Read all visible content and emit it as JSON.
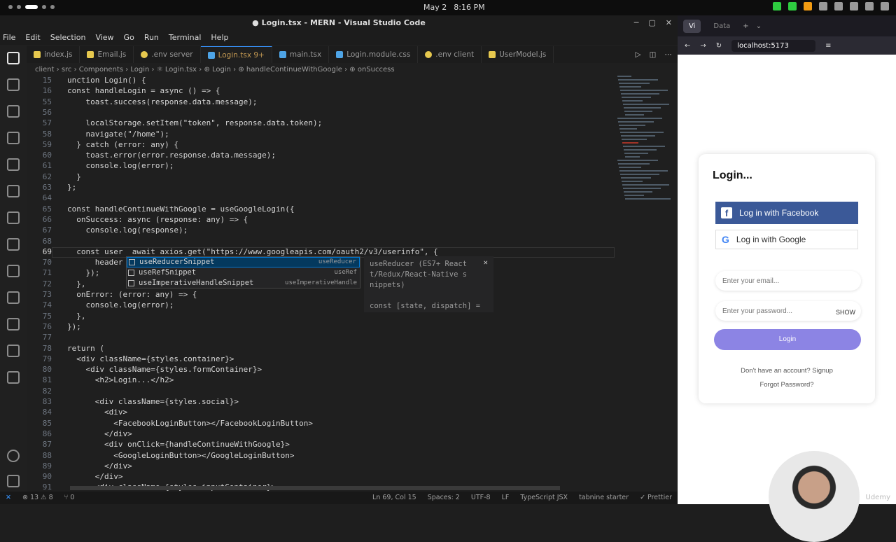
{
  "topbar": {
    "date": "May 2",
    "time": "8:16 PM"
  },
  "vscode": {
    "title": "● Login.tsx - MERN - Visual Studio Code",
    "menu": [
      "File",
      "Edit",
      "Selection",
      "View",
      "Go",
      "Run",
      "Terminal",
      "Help"
    ],
    "tabs": [
      {
        "label": "index.js",
        "type": "js"
      },
      {
        "label": "Email.js",
        "type": "js"
      },
      {
        "label": ".env  server",
        "type": "env"
      },
      {
        "label": "Login.tsx 9+",
        "type": "tsx",
        "active": true
      },
      {
        "label": "main.tsx",
        "type": "tsx"
      },
      {
        "label": "Login.module.css",
        "type": "css"
      },
      {
        "label": ".env  client",
        "type": "env"
      },
      {
        "label": "UserModel.js",
        "type": "js"
      }
    ],
    "breadcrumb": "client › src › Components › Login › ⚛ Login.tsx › ⊕ Login › ⊕ handleContinueWithGoogle › ⊕ onSuccess",
    "lines": [
      {
        "n": "15",
        "html": "unction Login() {"
      },
      {
        "n": "16",
        "html": "const handleLogin = async () => {"
      },
      {
        "n": "55",
        "html": "    toast.success(response.data.message);"
      },
      {
        "n": "56",
        "html": ""
      },
      {
        "n": "57",
        "html": "    localStorage.setItem(\"token\", response.data.token);"
      },
      {
        "n": "58",
        "html": "    navigate(\"/home\");"
      },
      {
        "n": "59",
        "html": "  } catch (error: any) {"
      },
      {
        "n": "60",
        "html": "    toast.error(error.response.data.message);"
      },
      {
        "n": "61",
        "html": "    console.log(error);"
      },
      {
        "n": "62",
        "html": "  }"
      },
      {
        "n": "63",
        "html": "};"
      },
      {
        "n": "64",
        "html": ""
      },
      {
        "n": "65",
        "html": "const handleContinueWithGoogle = useGoogleLogin({"
      },
      {
        "n": "66",
        "html": "  onSuccess: async (response: any) => {"
      },
      {
        "n": "67",
        "html": "    console.log(response);"
      },
      {
        "n": "68",
        "html": ""
      },
      {
        "n": "69",
        "html": "  const user  await axios.get(\"https://www.googleapis.com/oauth2/v3/userinfo\", {"
      },
      {
        "n": "70",
        "html": "      header"
      },
      {
        "n": "71",
        "html": "    });"
      },
      {
        "n": "72",
        "html": "  },"
      },
      {
        "n": "73",
        "html": "  onError: (error: any) => {"
      },
      {
        "n": "74",
        "html": "    console.log(error);"
      },
      {
        "n": "75",
        "html": "  },"
      },
      {
        "n": "76",
        "html": "});"
      },
      {
        "n": "77",
        "html": ""
      },
      {
        "n": "78",
        "html": "return ("
      },
      {
        "n": "79",
        "html": "  <div className={styles.container}>"
      },
      {
        "n": "80",
        "html": "    <div className={styles.formContainer}>"
      },
      {
        "n": "81",
        "html": "      <h2>Login...</h2>"
      },
      {
        "n": "82",
        "html": ""
      },
      {
        "n": "83",
        "html": "      <div className={styles.social}>"
      },
      {
        "n": "84",
        "html": "        <div>"
      },
      {
        "n": "85",
        "html": "          <FacebookLoginButton></FacebookLoginButton>"
      },
      {
        "n": "86",
        "html": "        </div>"
      },
      {
        "n": "87",
        "html": "        <div onClick={handleContinueWithGoogle}>"
      },
      {
        "n": "88",
        "html": "          <GoogleLoginButton></GoogleLoginButton>"
      },
      {
        "n": "89",
        "html": "        </div>"
      },
      {
        "n": "90",
        "html": "      </div>"
      },
      {
        "n": "91",
        "html": "      <div className={styles.inputContainer}>"
      }
    ],
    "suggestions": [
      {
        "label": "useReducerSnippet",
        "hint": "useReducer",
        "selected": true
      },
      {
        "label": "useRefSnippet",
        "hint": "useRef"
      },
      {
        "label": "useImperativeHandleSnippet",
        "hint": "useImperativeHandle"
      }
    ],
    "suggest_doc": [
      "useReducer (ES7+ React",
      "t/Redux/React-Native s",
      "nippets)",
      "",
      "const [state, dispatch] ="
    ],
    "status": {
      "errors": "⊗ 13 ⚠ 8",
      "ports": "⑂ 0",
      "position": "Ln 69, Col 15",
      "spaces": "Spaces: 2",
      "encoding": "UTF-8",
      "eol": "LF",
      "lang": "TypeScript JSX",
      "tabnine": "tabnine starter",
      "prettier": "✓ Prettier"
    }
  },
  "browser": {
    "tabs": [
      "Vi",
      "Data"
    ],
    "url": "localhost:5173",
    "login": {
      "title": "Login...",
      "facebook": "Log in with Facebook",
      "google": "Log in with Google",
      "email_placeholder": "Enter your email...",
      "password_placeholder": "Enter your password...",
      "show": "SHOW",
      "button": "Login",
      "signup": "Don't have an account? Signup",
      "forgot": "Forgot Password?"
    },
    "watermark": "Udemy"
  }
}
